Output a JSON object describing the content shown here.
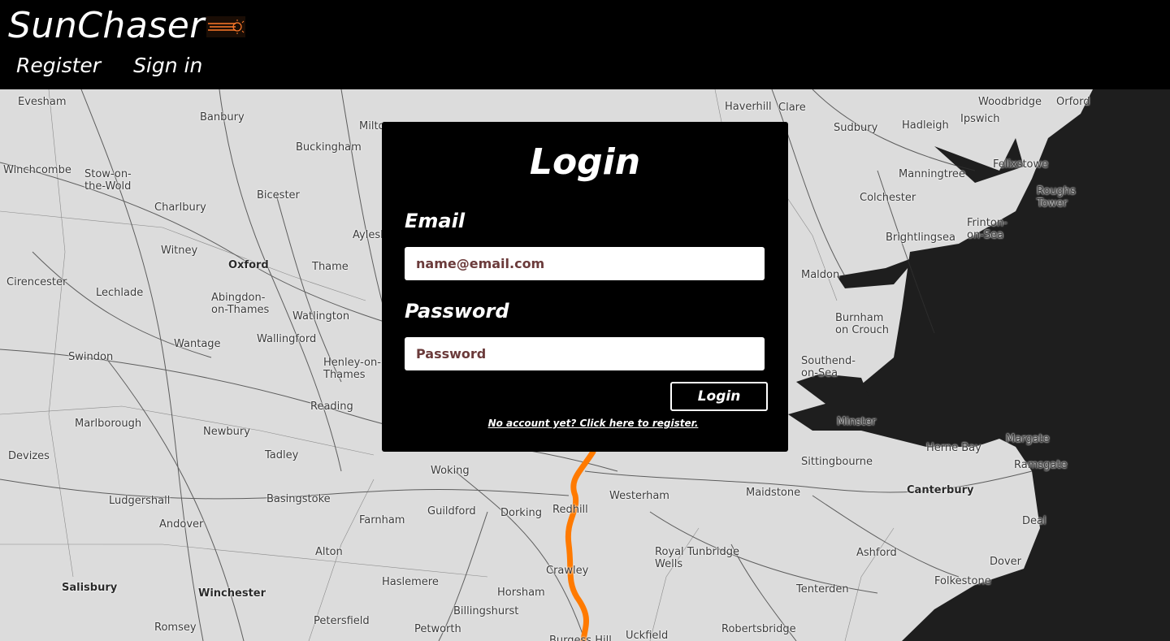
{
  "app": {
    "name": "SunChaser",
    "logo_icon": "sun-rays-icon"
  },
  "nav": {
    "register": "Register",
    "sign_in": "Sign in"
  },
  "login": {
    "title": "Login",
    "email_label": "Email",
    "email_placeholder": "name@email.com",
    "email_value": "",
    "password_label": "Password",
    "password_placeholder": "Password",
    "password_value": "",
    "submit_label": "Login",
    "register_link": "No account yet? Click here to register."
  },
  "map": {
    "route_color": "#ff7a00",
    "sea_color": "#1e1e1e",
    "land_color": "#dcdcdc",
    "places": [
      "Evesham",
      "Banbury",
      "Milton",
      "Buckingham",
      "Haverhill",
      "Clare",
      "Woodbridge",
      "Orford",
      "Sudbury",
      "Hadleigh",
      "Ipswich",
      "Felixstowe",
      "Winchcombe",
      "Stow-on-\nthe-Wold",
      "Bicester",
      "Manningtree",
      "Colchester",
      "Roughs\nTower",
      "Charlbury",
      "Witney",
      "Oxford",
      "Aylesbury",
      "Brightlingsea",
      "Frinton-\non-Sea",
      "Cirencester",
      "Lechlade",
      "Abingdon-\non-Thames",
      "Thame",
      "Maldon",
      "Watlington",
      "Burnham\non Crouch",
      "Wallingford",
      "Wantage",
      "Swindon",
      "Henley-on-\nThames",
      "Southend-\non-Sea",
      "Reading",
      "Marlborough",
      "Newbury",
      "Minster",
      "Margate",
      "Herne Bay",
      "Ramsgate",
      "Sittingbourne",
      "Devizes",
      "Tadley",
      "Woking",
      "Westerham",
      "Maidstone",
      "Canterbury",
      "Basingstoke",
      "Ludgershall",
      "Guildford",
      "Dorking",
      "Redhill",
      "Farnham",
      "Deal",
      "Andover",
      "Royal Tunbridge\nWells",
      "Ashford",
      "Alton",
      "Crawley",
      "Dover",
      "Haslemere",
      "Folkestone",
      "Salisbury",
      "Winchester",
      "Horsham",
      "Tenterden",
      "Billingshurst",
      "Petersfield",
      "Romsey",
      "Petworth",
      "Uckfield",
      "Robertsbridge",
      "Burgess Hill"
    ]
  }
}
